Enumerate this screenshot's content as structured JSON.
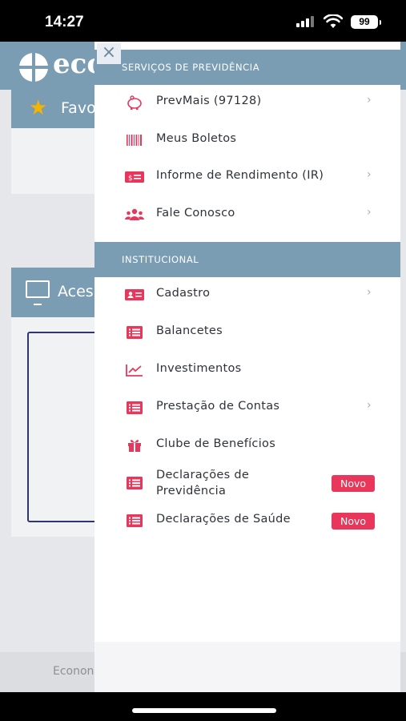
{
  "status_bar": {
    "time": "14:27",
    "battery": "99"
  },
  "background": {
    "logo_text": "eco",
    "favorites_label": "Favo",
    "access_label": "Aces",
    "footer_text": "Econon"
  },
  "drawer": {
    "close_icon": "close-icon",
    "sections": [
      {
        "title": "SERVIÇOS DE PREVIDÊNCIA",
        "items": [
          {
            "label": "PrevMais (97128)",
            "icon": "piggy-bank-icon",
            "chevron": "›"
          },
          {
            "label": "Meus Boletos",
            "icon": "barcode-icon"
          },
          {
            "label": "Informe de Rendimento (IR)",
            "icon": "money-bill-icon",
            "chevron": "›"
          },
          {
            "label": "Fale Conosco",
            "icon": "users-icon",
            "chevron": "›"
          }
        ]
      },
      {
        "title": "INSTITUCIONAL",
        "items": [
          {
            "label": "Cadastro",
            "icon": "id-card-icon",
            "chevron": "›"
          },
          {
            "label": "Balancetes",
            "icon": "list-icon"
          },
          {
            "label": "Investimentos",
            "icon": "chart-line-icon"
          },
          {
            "label": "Prestação de Contas",
            "icon": "list-icon",
            "chevron": "›"
          },
          {
            "label": "Clube de Benefícios",
            "icon": "gift-icon"
          },
          {
            "label_line1": "Declarações de",
            "label_line2": "Previdência",
            "icon": "list-icon",
            "badge": "Novo"
          },
          {
            "label": "Declarações de Saúde",
            "icon": "list-icon",
            "badge": "Novo"
          }
        ]
      }
    ]
  },
  "colors": {
    "accent": "#e8375b",
    "header": "#7a9db3"
  }
}
